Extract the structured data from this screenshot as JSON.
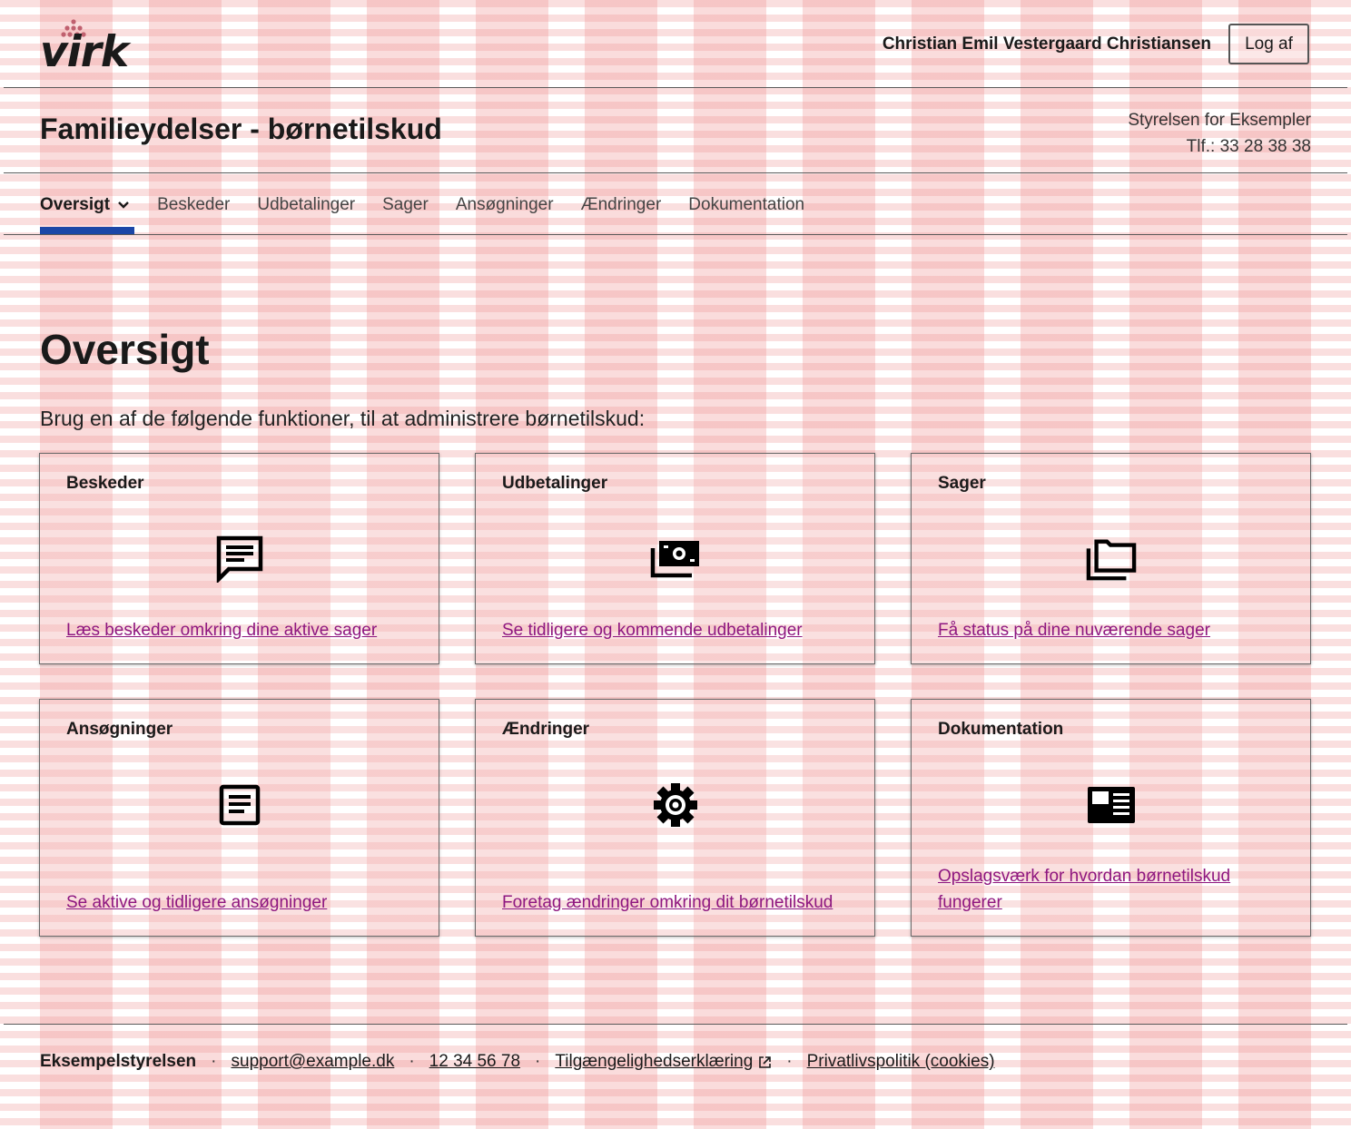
{
  "header": {
    "logo_text": "virk",
    "user_name": "Christian Emil Vestergaard Christiansen",
    "logout_label": "Log af"
  },
  "service": {
    "title": "Familieydelser - børnetilskud",
    "agency_name": "Styrelsen for Eksempler",
    "agency_phone": "Tlf.: 33 28 38 38"
  },
  "nav": {
    "items": [
      {
        "label": "Oversigt",
        "active": true
      },
      {
        "label": "Beskeder"
      },
      {
        "label": "Udbetalinger"
      },
      {
        "label": "Sager"
      },
      {
        "label": "Ansøgninger"
      },
      {
        "label": "Ændringer"
      },
      {
        "label": "Dokumentation"
      }
    ]
  },
  "main": {
    "heading": "Oversigt",
    "intro": "Brug en af de følgende funktioner, til at administrere børnetilskud:",
    "cards": [
      {
        "title": "Beskeder",
        "icon": "chat-icon",
        "link": "Læs beskeder omkring dine aktive sager"
      },
      {
        "title": "Udbetalinger",
        "icon": "money-icon",
        "link": "Se tidligere og kommende udbetalinger"
      },
      {
        "title": "Sager",
        "icon": "folder-icon",
        "link": "Få status på dine nuværende sager"
      },
      {
        "title": "Ansøgninger",
        "icon": "document-icon",
        "link": "Se aktive og tidligere ansøgninger"
      },
      {
        "title": "Ændringer",
        "icon": "gear-icon",
        "link": "Foretag ændringer omkring dit børnetilskud"
      },
      {
        "title": "Dokumentation",
        "icon": "article-icon",
        "link": "Opslagsværk for hvordan børnetilskud fungerer"
      }
    ]
  },
  "footer": {
    "org": "Eksempelstyrelsen",
    "email": "support@example.dk",
    "phone": "12 34 56 78",
    "accessibility": "Tilgængelighedserklæring",
    "privacy": "Privatlivspolitik (cookies)"
  },
  "colors": {
    "nav_indicator": "#1b47a7",
    "link": "#8e1780",
    "logo_dots": "#c0606f"
  }
}
